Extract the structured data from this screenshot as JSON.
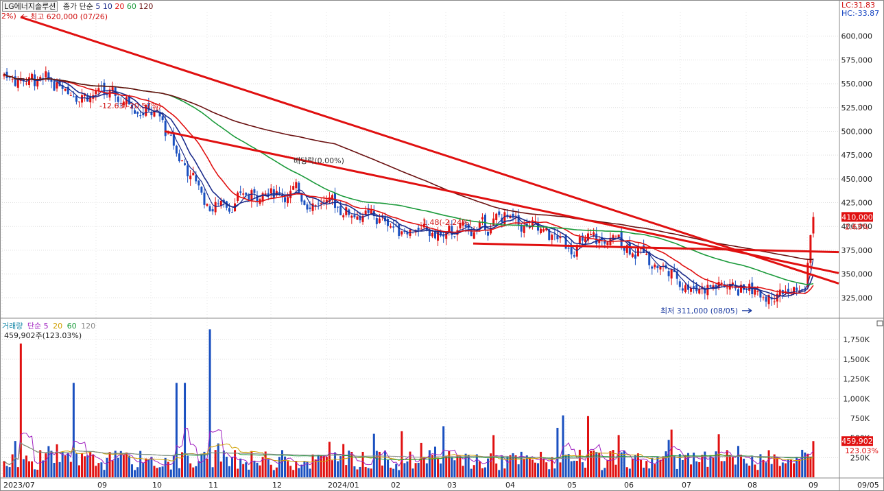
{
  "header": {
    "stock_name": "LG에너지솔루션",
    "price_label": "종가 단순",
    "ma_periods": [
      "5",
      "10",
      "20",
      "60",
      "120"
    ],
    "ma_colors": [
      "#1a2a8a",
      "#1a2a8a",
      "#e01010",
      "#1a9a3a",
      "#6a1010"
    ],
    "lc_label": "LC:31.83",
    "hc_label": "HC:-33.87",
    "corner_pct": "2%)"
  },
  "price_panel": {
    "annotations": {
      "high": "최고 620,000 (07/26)",
      "low": "최저 311,000 (08/05)",
      "pct1": "-12.63(-20.57%)",
      "pct2": "-1.48(-2.24%)",
      "dividend": "배당락(0.00%)"
    },
    "current_price_tag": "410,000",
    "current_change_tag": "2.63%"
  },
  "volume_panel": {
    "label": "거래량",
    "ma_label": "단순",
    "ma_periods": [
      "5",
      "20",
      "60",
      "120"
    ],
    "ma_colors": [
      "#a020c0",
      "#d0a000",
      "#1a9a3a",
      "#888888"
    ],
    "summary": "459,902주(123.03%)",
    "current_tag": "459,902",
    "current_pct": "123.03%"
  },
  "chart_data": [
    {
      "type": "candlestick",
      "title": "LG에너지솔루션",
      "x_ticks": [
        "2023/07",
        "09",
        "10",
        "11",
        "12",
        "2024/01",
        "02",
        "03",
        "04",
        "05",
        "06",
        "07",
        "08",
        "09",
        "09/05"
      ],
      "y_ticks": [
        600000,
        575000,
        550000,
        525000,
        500000,
        475000,
        450000,
        425000,
        400000,
        375000,
        350000,
        325000
      ],
      "ylim": [
        305000,
        625000
      ],
      "series_close_approx": [
        {
          "month": "2023/07",
          "close": 560000
        },
        {
          "month": "08",
          "close": 540000
        },
        {
          "month": "09",
          "close": 520000
        },
        {
          "month": "10",
          "close": 420000
        },
        {
          "month": "11",
          "close": 440000
        },
        {
          "month": "12",
          "close": 425000
        },
        {
          "month": "2024/01",
          "close": 400000
        },
        {
          "month": "02",
          "close": 390000
        },
        {
          "month": "03",
          "close": 410000
        },
        {
          "month": "04",
          "close": 380000
        },
        {
          "month": "05",
          "close": 385000
        },
        {
          "month": "06",
          "close": 340000
        },
        {
          "month": "07",
          "close": 335000
        },
        {
          "month": "08",
          "close": 330000
        },
        {
          "month": "09",
          "close": 410000
        }
      ],
      "high": 620000,
      "low": 311000,
      "last": 410000
    },
    {
      "type": "bar",
      "title": "거래량",
      "y_ticks": [
        "1,750K",
        "1,500K",
        "1,250K",
        "1,000K",
        "750K",
        "500K",
        "250K"
      ],
      "ylim": [
        0,
        1900000
      ],
      "last_volume": 459902
    }
  ]
}
